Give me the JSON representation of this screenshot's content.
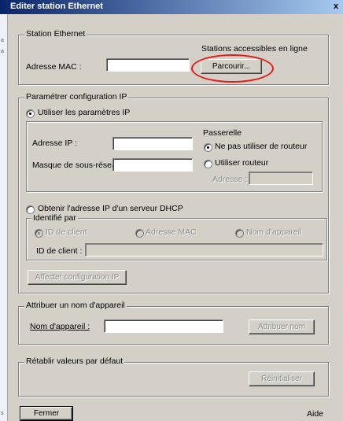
{
  "window": {
    "title": "Editer station Ethernet",
    "close_glyph": "x"
  },
  "left_strip": {
    "glyphs": [
      "a",
      "a",
      "s"
    ]
  },
  "station_ethernet": {
    "legend": "Station Ethernet",
    "online_label": "Stations accessibles en ligne",
    "mac_label": "Adresse MAC :",
    "mac_value": "",
    "browse_button": "Parcourir..."
  },
  "ip_config": {
    "legend": "Paramétrer configuration IP",
    "use_ip_params": "Utiliser les paramètres IP",
    "ip_label": "Adresse IP :",
    "ip_value": "",
    "subnet_label": "Masque de sous-réseau :",
    "subnet_value": "",
    "gateway": {
      "title": "Passerelle",
      "no_router": "Ne pas utiliser de routeur",
      "use_router": "Utiliser routeur",
      "address_label": "Adresse :",
      "address_value": ""
    },
    "dhcp_option": "Obtenir l'adresse IP d'un serveur DHCP",
    "identified_by": {
      "legend": "Identifié par",
      "client_id": "ID de client",
      "mac_address": "Adresse MAC",
      "device_name": "Nom d'appareil",
      "client_id_label": "ID de client :",
      "client_id_value": ""
    },
    "assign_button": "Affecter configuration IP"
  },
  "device_name": {
    "legend": "Attribuer un nom d'appareil",
    "label": "Nom d'appareil :",
    "value": "",
    "assign_button": "Attribuer nom"
  },
  "reset": {
    "legend": "Rétablir valeurs par défaut",
    "button": "Réinitialiser"
  },
  "footer": {
    "close_button": "Fermer",
    "help_button": "Aide"
  },
  "state": {
    "selected_ip_mode": "use_ip_params",
    "selected_gateway": "no_router",
    "selected_identifier": "client_id"
  },
  "colors": {
    "annotation_ellipse": "#e41b1b",
    "title_bar": "#0a246a"
  }
}
